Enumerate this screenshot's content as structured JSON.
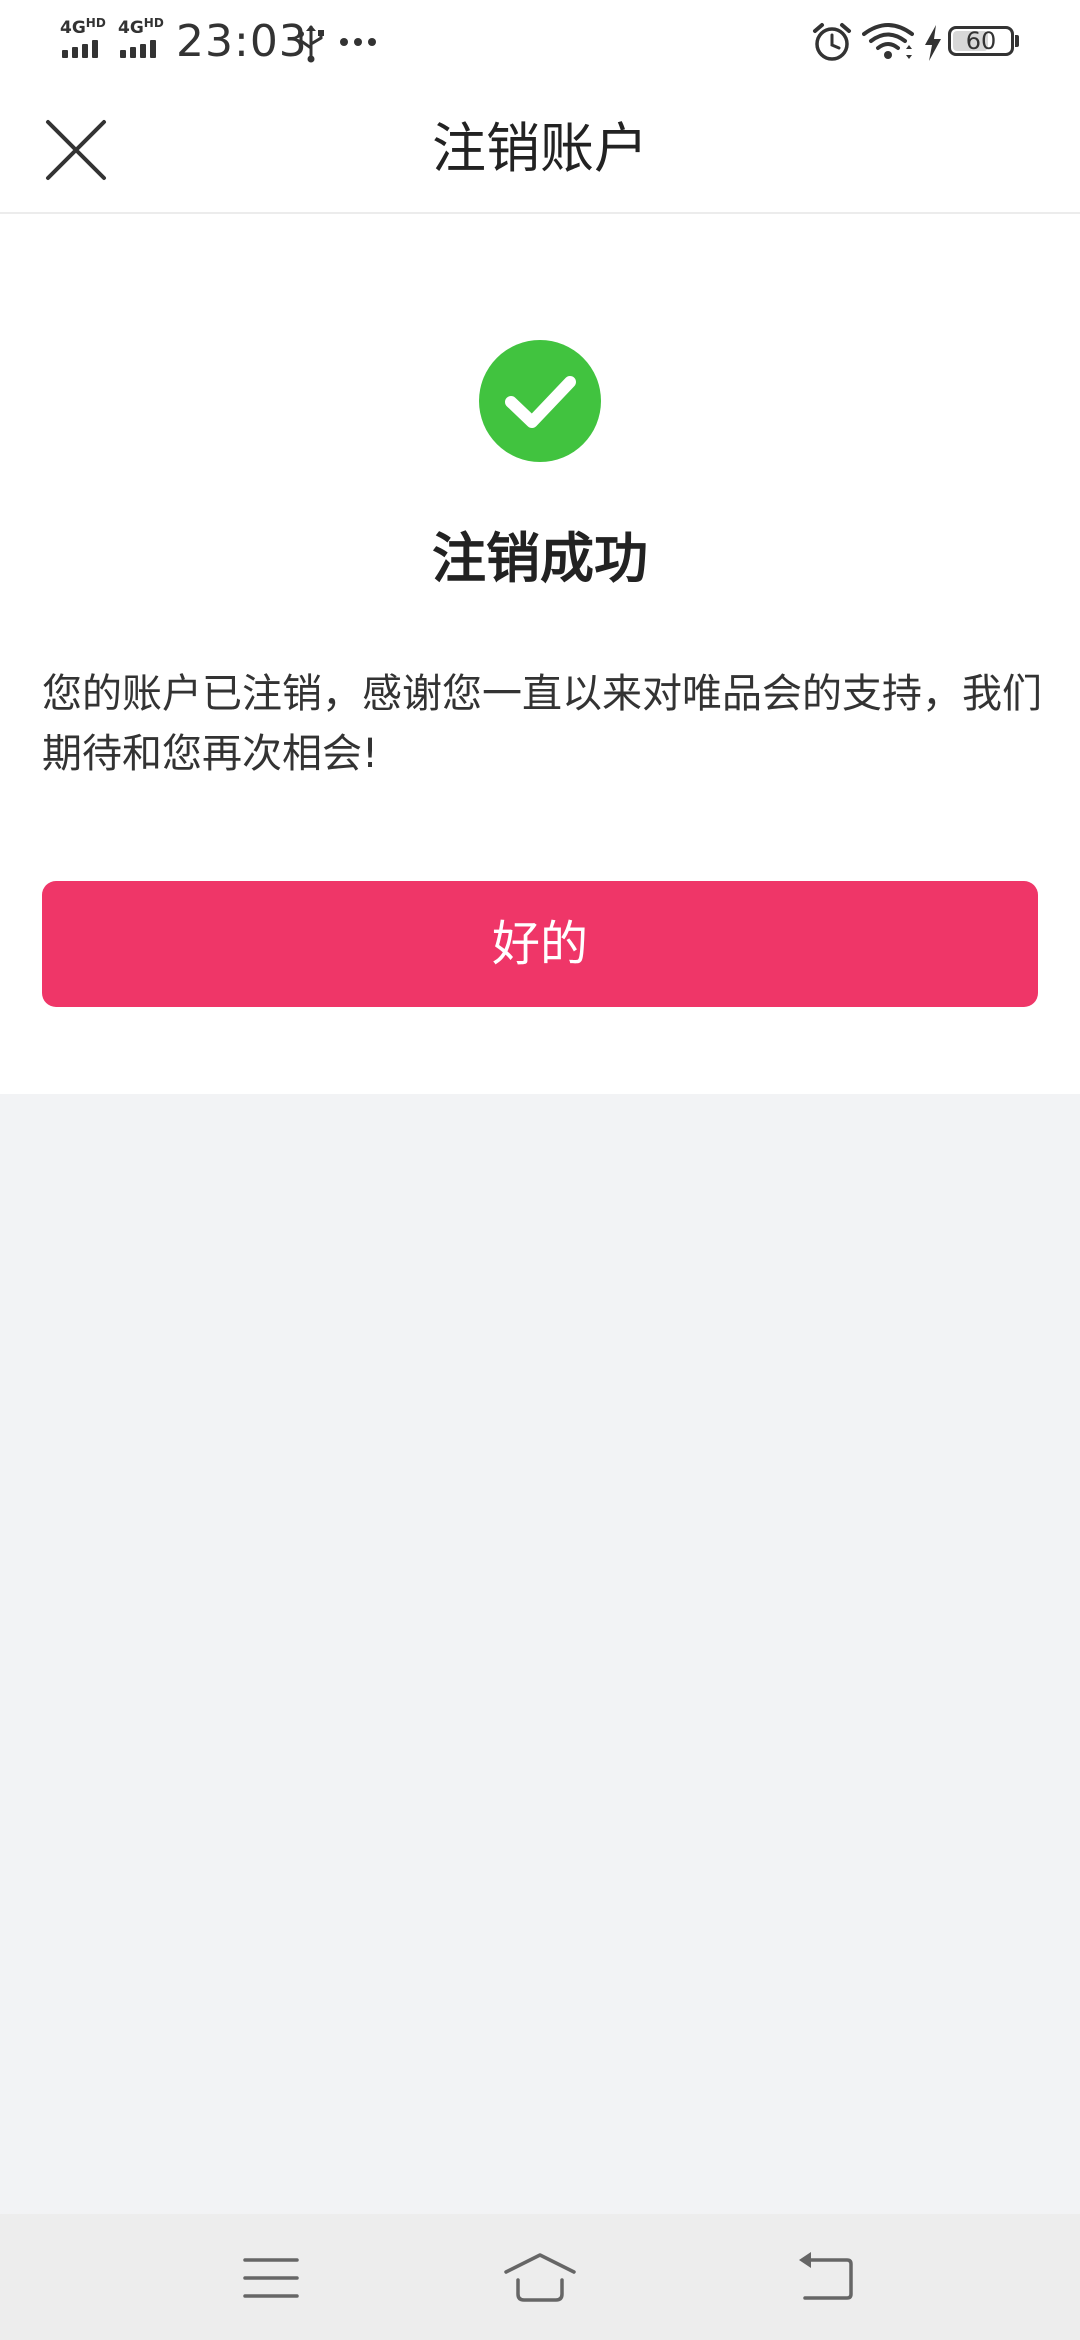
{
  "status_bar": {
    "network_1": "4G",
    "network_1_suffix": "HD",
    "network_2": "4G",
    "network_2_suffix": "HD",
    "time": "23:03",
    "battery_level": "60",
    "icons": [
      "signal-icon",
      "usb-icon",
      "more-dots-icon",
      "alarm-icon",
      "wifi-icon",
      "charging-icon",
      "battery-icon"
    ]
  },
  "header": {
    "title": "注销账户",
    "close_icon": "close-icon"
  },
  "result": {
    "icon": "check-circle-icon",
    "icon_color": "#41c33f",
    "title": "注销成功",
    "description": "您的账户已注销，感谢您一直以来对唯品会的支持，我们期待和您再次相会!",
    "button_label": "好的",
    "button_color": "#ef3668"
  },
  "nav_bar": {
    "icons": [
      "menu-icon",
      "home-icon",
      "back-icon"
    ]
  }
}
